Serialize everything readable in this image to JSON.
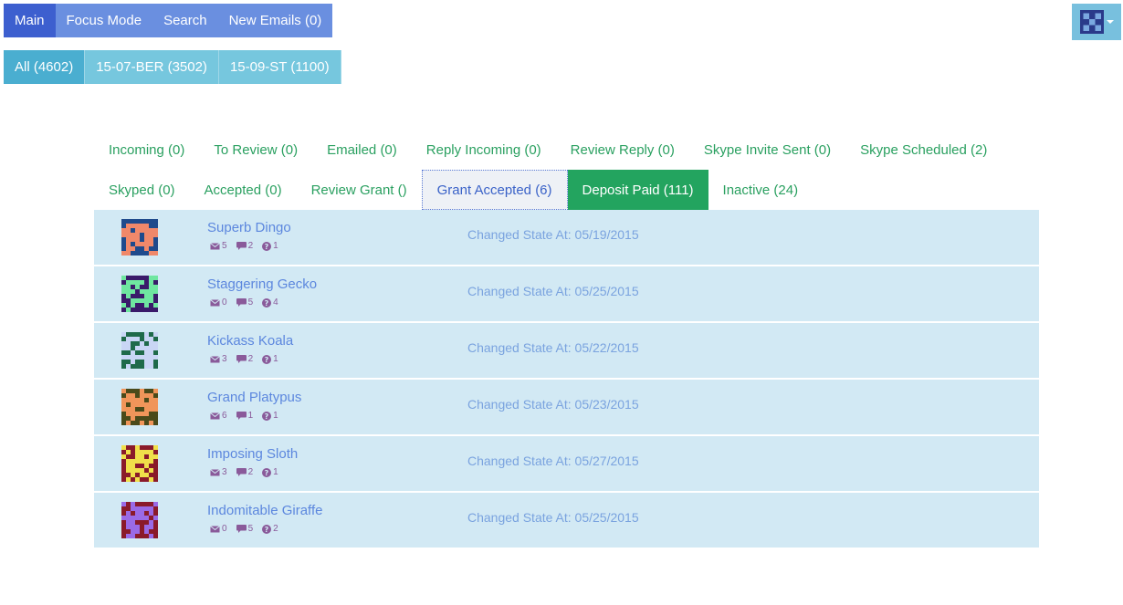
{
  "nav": {
    "items": [
      {
        "label": "Main",
        "active": true
      },
      {
        "label": "Focus Mode",
        "active": false
      },
      {
        "label": "Search",
        "active": false
      },
      {
        "label": "New Emails (0)",
        "active": false
      }
    ]
  },
  "user_menu": {
    "icon": "user-avatar-icon"
  },
  "cohorts": {
    "items": [
      {
        "label": "All (4602)",
        "active": true
      },
      {
        "label": "15-07-BER (3502)",
        "active": false
      },
      {
        "label": "15-09-ST (1100)",
        "active": false
      }
    ]
  },
  "tabs": {
    "row1": [
      {
        "label": "Incoming (0)"
      },
      {
        "label": "To Review (0)"
      },
      {
        "label": "Emailed (0)"
      },
      {
        "label": "Reply Incoming (0)"
      },
      {
        "label": "Review Reply (0)"
      },
      {
        "label": "Skype Invite Sent (0)"
      },
      {
        "label": "Skype Scheduled (2)"
      }
    ],
    "row2": [
      {
        "label": "Skyped (0)"
      },
      {
        "label": "Accepted (0)"
      },
      {
        "label": "Review Grant ()"
      },
      {
        "label": "Grant Accepted (6)",
        "state": "focused"
      },
      {
        "label": "Deposit Paid (111)",
        "state": "active"
      },
      {
        "label": "Inactive (24)"
      }
    ]
  },
  "applicants": [
    {
      "name": "Superb Dingo",
      "emails": "5",
      "comments": "2",
      "questions": "1",
      "changed": "Changed State At: 05/19/2015",
      "avatar_fg": "#f0886a",
      "avatar_bg": "#1f4a8c"
    },
    {
      "name": "Staggering Gecko",
      "emails": "0",
      "comments": "5",
      "questions": "4",
      "changed": "Changed State At: 05/25/2015",
      "avatar_fg": "#6fe6a0",
      "avatar_bg": "#3a1a6a"
    },
    {
      "name": "Kickass Koala",
      "emails": "3",
      "comments": "2",
      "questions": "1",
      "changed": "Changed State At: 05/22/2015",
      "avatar_fg": "#c9d6f5",
      "avatar_bg": "#1f6a4a"
    },
    {
      "name": "Grand Platypus",
      "emails": "6",
      "comments": "1",
      "questions": "1",
      "changed": "Changed State At: 05/23/2015",
      "avatar_fg": "#f0955a",
      "avatar_bg": "#4a4a1a"
    },
    {
      "name": "Imposing Sloth",
      "emails": "3",
      "comments": "2",
      "questions": "1",
      "changed": "Changed State At: 05/27/2015",
      "avatar_fg": "#f0e04a",
      "avatar_bg": "#8a1a2a"
    },
    {
      "name": "Indomitable Giraffe",
      "emails": "0",
      "comments": "5",
      "questions": "2",
      "changed": "Changed State At: 05/25/2015",
      "avatar_fg": "#9a6ae6",
      "avatar_bg": "#8a1a2a"
    }
  ]
}
